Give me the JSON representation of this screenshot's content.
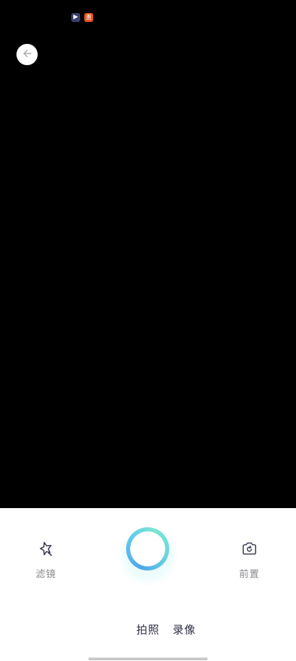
{
  "status_bar": {
    "icons": [
      {
        "icon": "video-app-icon",
        "glyph": "▶"
      },
      {
        "icon": "app-badge-icon",
        "glyph": "惠"
      }
    ]
  },
  "camera": {
    "back_icon": "arrow-left-icon"
  },
  "controls": {
    "filter_label": "滤镜",
    "filter_icon": "filter-star-icon",
    "switch_label": "前置",
    "switch_icon": "camera-flip-icon",
    "shutter_icon": "shutter-ring"
  },
  "modes": {
    "tabs": [
      {
        "label": "拍照"
      },
      {
        "label": "录像"
      }
    ]
  },
  "colors": {
    "preview_background": "#000000",
    "panel_background": "#ffffff",
    "label_gray": "#8a8a8f",
    "mode_text": "#2d2f45",
    "shutter_gradient_start": "#4fa6ea",
    "shutter_gradient_end": "#7ae6d2"
  }
}
